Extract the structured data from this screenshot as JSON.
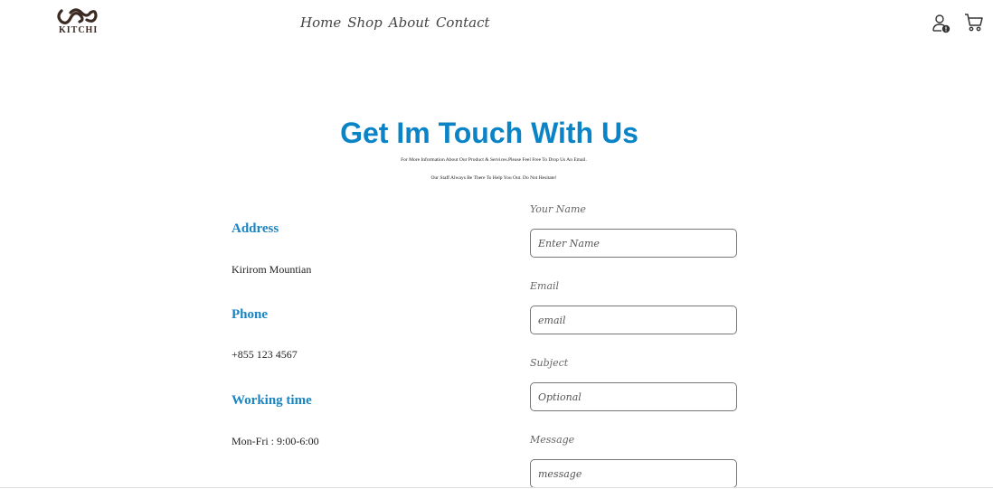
{
  "brand": {
    "logo_text": "KITCHI"
  },
  "nav": {
    "items": [
      "Home",
      "Shop",
      "About",
      "Contact"
    ]
  },
  "header_icons": [
    "user-icon",
    "cart-icon"
  ],
  "contact": {
    "title": "Get Im Touch With Us",
    "subtitle_line1": "For More Information About Our Product & Services.Please Feel Free To Drop Us An Email.",
    "subtitle_line2": "Our Staff Always Be There To Help You Out. Do Not Hesitate!"
  },
  "info": {
    "address_label": "Address",
    "address_value": "Kirirom Mountian",
    "phone_label": "Phone",
    "phone_value": "+855 123 4567",
    "hours_label": "Working time",
    "hours_value": "Mon-Fri : 9:00-6:00"
  },
  "form": {
    "name_label": "Your Name",
    "name_placeholder": "Enter Name",
    "email_label": "Email",
    "email_placeholder": "email",
    "subject_label": "Subject",
    "subject_placeholder": "Optional",
    "message_label": "Message",
    "message_placeholder": "message"
  },
  "colors": {
    "accent": "#0a84c6",
    "heading": "#1a85c2",
    "logo": "#3b2a22"
  }
}
